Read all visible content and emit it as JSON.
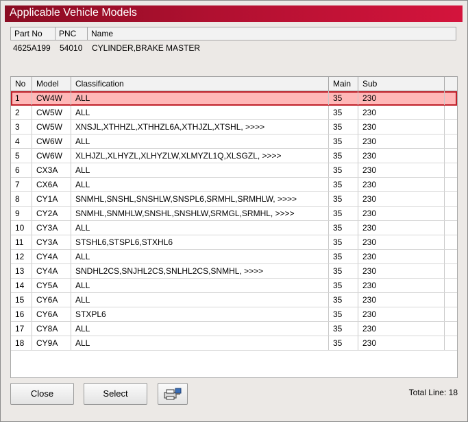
{
  "window": {
    "title": "Applicable Vehicle Models"
  },
  "part": {
    "headers": {
      "part_no": "Part No",
      "pnc": "PNC",
      "name": "Name"
    },
    "values": {
      "part_no": "4625A199",
      "pnc": "54010",
      "name": "CYLINDER,BRAKE MASTER"
    }
  },
  "grid": {
    "headers": {
      "no": "No",
      "model": "Model",
      "classification": "Classification",
      "main": "Main",
      "sub": "Sub"
    },
    "rows": [
      {
        "no": "1",
        "model": "CW4W",
        "classification": "ALL",
        "main": "35",
        "sub": "230",
        "selected": true
      },
      {
        "no": "2",
        "model": "CW5W",
        "classification": "ALL",
        "main": "35",
        "sub": "230"
      },
      {
        "no": "3",
        "model": "CW5W",
        "classification": "XNSJL,XTHHZL,XTHHZL6A,XTHJZL,XTSHL,  >>>>",
        "main": "35",
        "sub": "230"
      },
      {
        "no": "4",
        "model": "CW6W",
        "classification": "ALL",
        "main": "35",
        "sub": "230"
      },
      {
        "no": "5",
        "model": "CW6W",
        "classification": "XLHJZL,XLHYZL,XLHYZLW,XLMYZL1Q,XLSGZL,  >>>>",
        "main": "35",
        "sub": "230"
      },
      {
        "no": "6",
        "model": "CX3A",
        "classification": "ALL",
        "main": "35",
        "sub": "230"
      },
      {
        "no": "7",
        "model": "CX6A",
        "classification": "ALL",
        "main": "35",
        "sub": "230"
      },
      {
        "no": "8",
        "model": "CY1A",
        "classification": "SNMHL,SNSHL,SNSHLW,SNSPL6,SRMHL,SRMHLW,  >>>>",
        "main": "35",
        "sub": "230"
      },
      {
        "no": "9",
        "model": "CY2A",
        "classification": "SNMHL,SNMHLW,SNSHL,SNSHLW,SRMGL,SRMHL,  >>>>",
        "main": "35",
        "sub": "230"
      },
      {
        "no": "10",
        "model": "CY3A",
        "classification": "ALL",
        "main": "35",
        "sub": "230"
      },
      {
        "no": "11",
        "model": "CY3A",
        "classification": "STSHL6,STSPL6,STXHL6",
        "main": "35",
        "sub": "230"
      },
      {
        "no": "12",
        "model": "CY4A",
        "classification": "ALL",
        "main": "35",
        "sub": "230"
      },
      {
        "no": "13",
        "model": "CY4A",
        "classification": "SNDHL2CS,SNJHL2CS,SNLHL2CS,SNMHL,  >>>>",
        "main": "35",
        "sub": "230"
      },
      {
        "no": "14",
        "model": "CY5A",
        "classification": "ALL",
        "main": "35",
        "sub": "230"
      },
      {
        "no": "15",
        "model": "CY6A",
        "classification": "ALL",
        "main": "35",
        "sub": "230"
      },
      {
        "no": "16",
        "model": "CY6A",
        "classification": "STXPL6",
        "main": "35",
        "sub": "230"
      },
      {
        "no": "17",
        "model": "CY8A",
        "classification": "ALL",
        "main": "35",
        "sub": "230"
      },
      {
        "no": "18",
        "model": "CY9A",
        "classification": "ALL",
        "main": "35",
        "sub": "230"
      }
    ]
  },
  "footer": {
    "close_label": "Close",
    "select_label": "Select",
    "print_icon": "printer-icon",
    "total_text": "Total Line: 18"
  },
  "colors": {
    "title_start": "#8a0c22",
    "title_end": "#d4143c",
    "selected_fill": "#ffb8b8",
    "selected_border": "#c0202a"
  }
}
